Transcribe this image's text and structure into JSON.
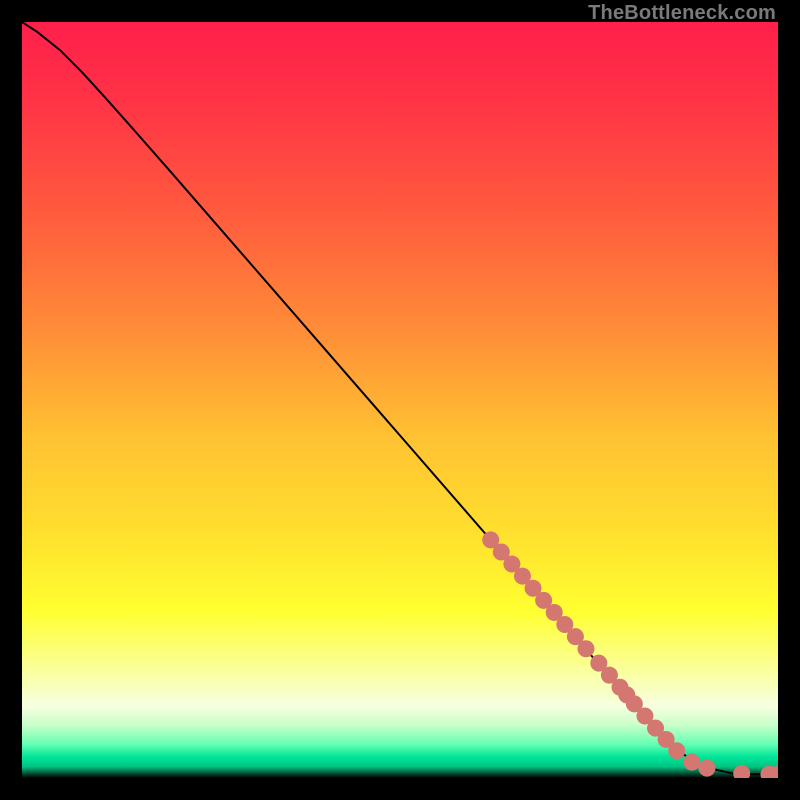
{
  "watermark": "TheBottleneck.com",
  "colors": {
    "dot": "#d57771",
    "line": "#000000",
    "frame": "#000000"
  },
  "chart_data": {
    "type": "line",
    "title": "",
    "xlabel": "",
    "ylabel": "",
    "xlim": [
      0,
      100
    ],
    "ylim": [
      0,
      100
    ],
    "grid": false,
    "gradient_stops": [
      {
        "offset": 0.0,
        "color": "#ff1f4b"
      },
      {
        "offset": 0.1,
        "color": "#ff3246"
      },
      {
        "offset": 0.25,
        "color": "#ff5a3e"
      },
      {
        "offset": 0.4,
        "color": "#ff8a38"
      },
      {
        "offset": 0.55,
        "color": "#ffc232"
      },
      {
        "offset": 0.68,
        "color": "#ffe12e"
      },
      {
        "offset": 0.78,
        "color": "#ffff30"
      },
      {
        "offset": 0.86,
        "color": "#faffa0"
      },
      {
        "offset": 0.905,
        "color": "#f6ffe0"
      },
      {
        "offset": 0.93,
        "color": "#c8ffc8"
      },
      {
        "offset": 0.955,
        "color": "#66ffb3"
      },
      {
        "offset": 0.972,
        "color": "#00e598"
      },
      {
        "offset": 0.985,
        "color": "#00c582"
      },
      {
        "offset": 1.0,
        "color": "#000000"
      }
    ],
    "series": [
      {
        "name": "curve",
        "x": [
          0.0,
          2.0,
          5.0,
          8.0,
          11.0,
          15.0,
          20.0,
          30.0,
          40.0,
          50.0,
          60.0,
          70.0,
          80.0,
          86.0,
          90.0,
          94.0,
          97.0,
          100.0
        ],
        "y": [
          100.0,
          98.7,
          96.3,
          93.3,
          90.0,
          85.5,
          79.8,
          68.3,
          56.8,
          45.3,
          33.8,
          22.3,
          10.8,
          4.1,
          1.5,
          0.6,
          0.5,
          0.5
        ]
      }
    ],
    "scatter": [
      {
        "name": "dots",
        "x": [
          62.0,
          63.4,
          64.8,
          66.2,
          67.6,
          69.0,
          70.4,
          71.8,
          73.2,
          74.6,
          76.3,
          77.7,
          79.1,
          80.0,
          81.0,
          82.4,
          83.8,
          85.2,
          86.6,
          88.6,
          90.6,
          95.2,
          98.8,
          100.0
        ],
        "y": [
          31.5,
          29.9,
          28.3,
          26.7,
          25.1,
          23.5,
          21.9,
          20.3,
          18.7,
          17.1,
          15.2,
          13.6,
          12.0,
          11.0,
          9.8,
          8.2,
          6.6,
          5.1,
          3.6,
          2.1,
          1.3,
          0.6,
          0.5,
          0.5
        ]
      }
    ]
  }
}
